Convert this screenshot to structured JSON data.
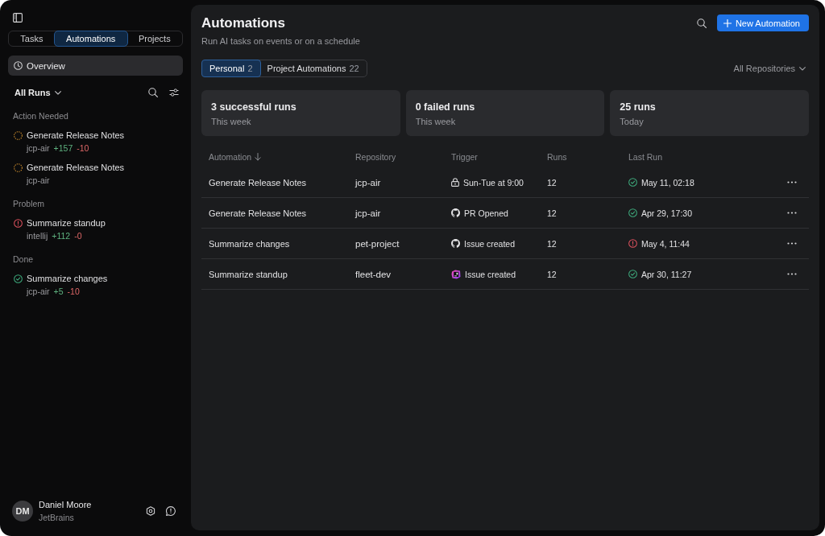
{
  "sidebar": {
    "tabs": [
      {
        "label": "Tasks",
        "selected": false
      },
      {
        "label": "Automations",
        "selected": true
      },
      {
        "label": "Projects",
        "selected": false
      }
    ],
    "overview": {
      "label": "Overview",
      "selected": true
    },
    "runs_filter": "All Runs",
    "groups": [
      {
        "title": "Action Needed",
        "items": [
          {
            "kind": "pending",
            "title": "Generate Release Notes",
            "repo": "jcp-air",
            "added": "+157",
            "removed": "-10"
          },
          {
            "kind": "pending",
            "title": "Generate Release Notes",
            "repo": "jcp-air"
          }
        ]
      },
      {
        "title": "Problem",
        "items": [
          {
            "kind": "error",
            "title": "Summarize standup",
            "repo": "intellij",
            "added": "+112",
            "removed": "-0"
          }
        ]
      },
      {
        "title": "Done",
        "items": [
          {
            "kind": "success",
            "title": "Summarize changes",
            "repo": "jcp-air",
            "added": "+5",
            "removed": "-10"
          }
        ]
      }
    ],
    "user": {
      "initials": "DM",
      "name": "Daniel Moore",
      "org": "JetBrains"
    }
  },
  "main": {
    "title": "Automations",
    "subtitle": "Run AI tasks on events or on a schedule",
    "new_button": "New Automation",
    "tabs": [
      {
        "label": "Personal",
        "count": "2",
        "selected": true
      },
      {
        "label": "Project Automations",
        "count": "22",
        "selected": false
      }
    ],
    "repository_filter": "All Repositories",
    "stats": [
      {
        "title": "3 successful runs",
        "period": "This week"
      },
      {
        "title": "0 failed runs",
        "period": "This week"
      },
      {
        "title": "25 runs",
        "period": "Today"
      }
    ],
    "table": {
      "columns": [
        {
          "label": "Automation",
          "sorted": true
        },
        {
          "label": "Repository",
          "sorted": false
        },
        {
          "label": "Trigger",
          "sorted": false
        },
        {
          "label": "Runs",
          "sorted": false
        },
        {
          "label": "Last Run",
          "sorted": false
        }
      ],
      "rows": [
        {
          "automation": "Generate Release Notes",
          "repository": "jcp-air",
          "trigger": {
            "kind": "schedule",
            "label": "Sun-Tue at 9:00"
          },
          "runs": "12",
          "last_run": {
            "kind": "success",
            "time": "May 11, 02:18"
          }
        },
        {
          "automation": "Generate Release Notes",
          "repository": "jcp-air",
          "trigger": {
            "kind": "github",
            "label": "PR Opened"
          },
          "runs": "12",
          "last_run": {
            "kind": "success",
            "time": "Apr 29, 17:30"
          }
        },
        {
          "automation": "Summarize changes",
          "repository": "pet-project",
          "trigger": {
            "kind": "github",
            "label": "Issue created"
          },
          "runs": "12",
          "last_run": {
            "kind": "error",
            "time": "May 4, 11:44"
          }
        },
        {
          "automation": "Summarize standup",
          "repository": "fleet-dev",
          "trigger": {
            "kind": "tracker",
            "label": "Issue created"
          },
          "runs": "12",
          "last_run": {
            "kind": "success",
            "time": "Apr 30, 11:27"
          }
        }
      ]
    }
  }
}
